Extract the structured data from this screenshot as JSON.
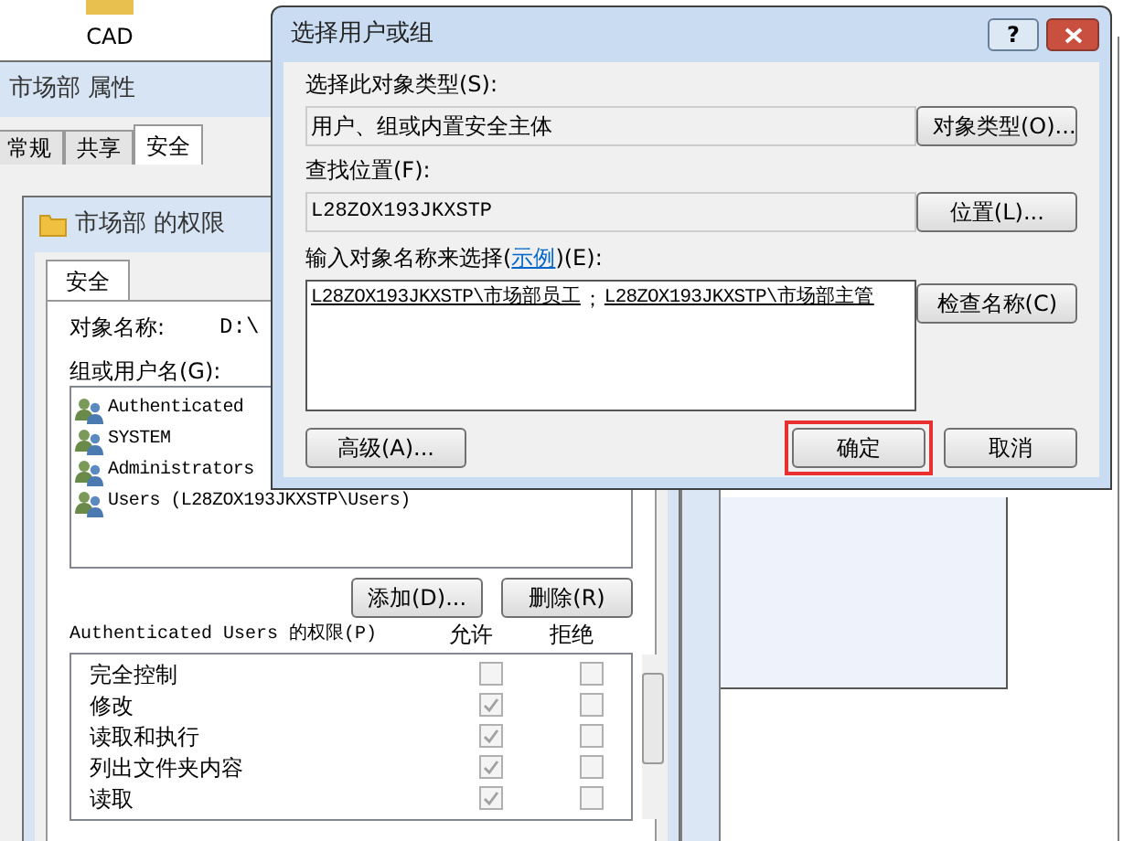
{
  "desktop": {
    "icons": [
      {
        "label": "CAD"
      }
    ]
  },
  "properties_window": {
    "title": "市场部 属性",
    "tabs": [
      {
        "label": "常规",
        "selected": false
      },
      {
        "label": "共享",
        "selected": false
      },
      {
        "label": "安全",
        "selected": true
      }
    ]
  },
  "permissions_window": {
    "title": "市场部 的权限",
    "tabs": [
      {
        "label": "安全",
        "selected": true
      }
    ],
    "object_label": "对象名称:",
    "object_value": "D:\\",
    "group_label": "组或用户名(G):",
    "principals": [
      {
        "name": "Authenticated"
      },
      {
        "name": "SYSTEM"
      },
      {
        "name": "Administrators"
      },
      {
        "name": "Users (L28ZOX193JKXSTP\\Users)"
      }
    ],
    "add_button": "添加(D)...",
    "remove_button": "删除(R)",
    "permissions_label": "Authenticated Users 的权限(P)",
    "allow_header": "允许",
    "deny_header": "拒绝",
    "permissions": [
      {
        "label": "完全控制",
        "allow": false,
        "deny": false
      },
      {
        "label": "修改",
        "allow": true,
        "deny": false
      },
      {
        "label": "读取和执行",
        "allow": true,
        "deny": false
      },
      {
        "label": "列出文件夹内容",
        "allow": true,
        "deny": false
      },
      {
        "label": "读取",
        "allow": true,
        "deny": false
      }
    ]
  },
  "select_dialog": {
    "title": "选择用户或组",
    "help_button": "?",
    "object_type_label": "选择此对象类型(S):",
    "object_type_value": "用户、组或内置安全主体",
    "object_type_button": "对象类型(O)...",
    "location_label": "查找位置(F):",
    "location_value": "L28ZOX193JKXSTP",
    "location_button": "位置(L)...",
    "names_label_before": "输入对象名称来选择(",
    "names_label_link": "示例",
    "names_label_after": ")(E):",
    "names": [
      "L28ZOX193JKXSTP\\市场部员工",
      "L28ZOX193JKXSTP\\市场部主管"
    ],
    "names_separator": "；",
    "check_names_button": "检查名称(C)",
    "advanced_button": "高级(A)...",
    "ok_button": "确定",
    "ok_highlighted": true,
    "cancel_button": "取消"
  }
}
